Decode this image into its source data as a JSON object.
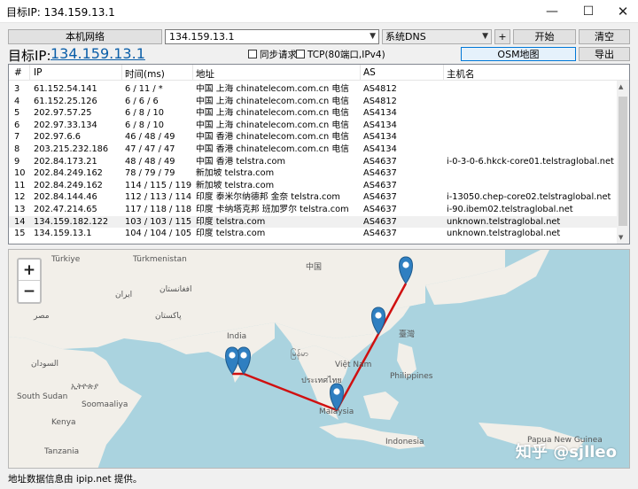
{
  "window": {
    "title": "目标IP: 134.159.13.1",
    "minimize": "—",
    "maximize": "☐",
    "close": "✕"
  },
  "toolbar": {
    "local_network_label": "本机网络",
    "ip_input_value": "134.159.13.1",
    "dns_select_value": "系统DNS",
    "plus_label": "+",
    "start_label": "开始",
    "clear_label": "清空",
    "osm_map_label": "OSM地图",
    "export_label": "导出"
  },
  "target": {
    "label": "目标IP:",
    "ip": "134.159.13.1"
  },
  "options": {
    "sync_request": "同步请求",
    "tcp_mode": "TCP(80端口,IPv4)"
  },
  "table": {
    "columns": [
      "#",
      "IP",
      "时间(ms)",
      "地址",
      "AS",
      "主机名"
    ],
    "rows": [
      [
        "3",
        "61.152.54.141",
        "6 / 11 / *",
        "中国 上海 chinatelecom.com.cn 电信",
        "AS4812",
        ""
      ],
      [
        "4",
        "61.152.25.126",
        "6 / 6 / 6",
        "中国 上海 chinatelecom.com.cn 电信",
        "AS4812",
        ""
      ],
      [
        "5",
        "202.97.57.25",
        "6 / 8 / 10",
        "中国 上海 chinatelecom.com.cn 电信",
        "AS4134",
        ""
      ],
      [
        "6",
        "202.97.33.134",
        "6 / 8 / 10",
        "中国 上海 chinatelecom.com.cn 电信",
        "AS4134",
        ""
      ],
      [
        "7",
        "202.97.6.6",
        "46 / 48 / 49",
        "中国 香港 chinatelecom.com.cn 电信",
        "AS4134",
        ""
      ],
      [
        "8",
        "203.215.232.186",
        "47 / 47 / 47",
        "中国 香港 chinatelecom.com.cn 电信",
        "AS4134",
        ""
      ],
      [
        "9",
        "202.84.173.21",
        "48 / 48 / 49",
        "中国 香港 telstra.com",
        "AS4637",
        "i-0-3-0-6.hkck-core01.telstraglobal.net"
      ],
      [
        "10",
        "202.84.249.162",
        "78 / 79 / 79",
        "新加坡 telstra.com",
        "AS4637",
        ""
      ],
      [
        "11",
        "202.84.249.162",
        "114 / 115 / 119",
        "新加坡 telstra.com",
        "AS4637",
        ""
      ],
      [
        "12",
        "202.84.144.46",
        "112 / 113 / 114",
        "印度 泰米尔纳德邦 金奈 telstra.com",
        "AS4637",
        "i-13050.chep-core02.telstraglobal.net"
      ],
      [
        "13",
        "202.47.214.65",
        "117 / 118 / 118",
        "印度 卡纳塔克邦 班加罗尔 telstra.com",
        "AS4637",
        "i-90.ibem02.telstraglobal.net"
      ],
      [
        "14",
        "134.159.182.122",
        "103 / 103 / 115",
        "印度 telstra.com",
        "AS4637",
        "unknown.telstraglobal.net"
      ],
      [
        "15",
        "134.159.13.1",
        "104 / 104 / 105",
        "印度 telstra.com",
        "AS4637",
        "unknown.telstraglobal.net"
      ]
    ],
    "selected_row": 11
  },
  "map": {
    "zoom_in": "+",
    "zoom_out": "−",
    "labels": [
      {
        "text": "Türkiye",
        "cls": ""
      },
      {
        "text": "Türkmenistan",
        "cls": ""
      },
      {
        "text": "中国",
        "cls": ""
      },
      {
        "text": "افغانستان",
        "cls": ""
      },
      {
        "text": "ایران",
        "cls": ""
      },
      {
        "text": "پاکستان",
        "cls": ""
      },
      {
        "text": "مصر",
        "cls": ""
      },
      {
        "text": "India",
        "cls": ""
      },
      {
        "text": "السودان",
        "cls": ""
      },
      {
        "text": "ኢትዮጵያ",
        "cls": ""
      },
      {
        "text": "South Sudan",
        "cls": ""
      },
      {
        "text": "Soomaaliya",
        "cls": ""
      },
      {
        "text": "Kenya",
        "cls": ""
      },
      {
        "text": "Tanzania",
        "cls": ""
      },
      {
        "text": "Philippines",
        "cls": ""
      },
      {
        "text": "Malaysia",
        "cls": ""
      },
      {
        "text": "Indonesia",
        "cls": ""
      },
      {
        "text": "ประเทศไทย",
        "cls": ""
      },
      {
        "text": "မြန်မာ",
        "cls": ""
      },
      {
        "text": "Việt Nam",
        "cls": ""
      },
      {
        "text": "臺灣",
        "cls": ""
      },
      {
        "text": "Papua New Guinea",
        "cls": ""
      }
    ],
    "route_color": "#d01010",
    "marker_color": "#2f7fc1"
  },
  "watermark": "知乎 @sjlleo",
  "footer": {
    "text": "地址数据信息由 ipip.net 提供。"
  }
}
